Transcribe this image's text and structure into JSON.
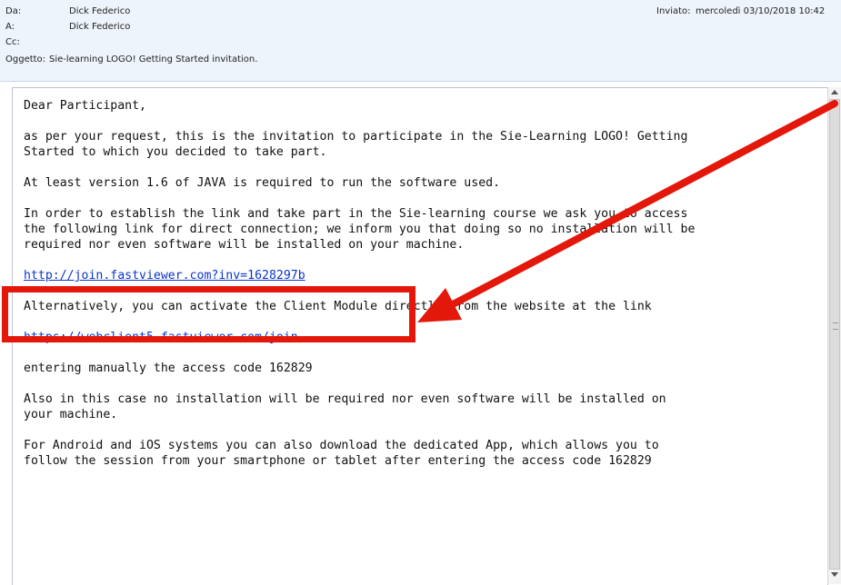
{
  "header": {
    "from_label": "Da:",
    "from_value": "Dick Federico",
    "to_label": "A:",
    "to_value": "Dick Federico",
    "cc_label": "Cc:",
    "cc_value": "",
    "subject_label": "Oggetto:",
    "subject_value": "Sie-learning LOGO! Getting Started invitation.",
    "sent_label": "Inviato:",
    "sent_value": "mercoledì 03/10/2018 10:42"
  },
  "body": {
    "greeting": "Dear Participant,",
    "p1": "as per your request, this is the invitation to participate in the Sie-Learning LOGO! Getting\nStarted to which you decided to take part.",
    "p2": "At least version 1.6 of JAVA is required to run the software used.",
    "p3": "In order to establish the link and take part in the Sie-learning course we ask you to access\nthe following link for direct connection; we inform you that doing so no installation will be\nrequired nor even software will be installed on your machine.",
    "link1": "http://join.fastviewer.com?inv=1628297b",
    "p4": "Alternatively, you can activate the Client Module directly from the website at the link",
    "link2": "https://webclient5.fastviewer.com/join",
    "p5": "entering manually the access code 162829",
    "p6": "Also in this case no installation will be required nor even software will be installed on\nyour machine.",
    "p7": "For Android and iOS systems you can also download the dedicated App, which allows you to\nfollow the session from your smartphone or tablet after entering the access code 162829"
  },
  "annotation": {
    "color": "#e3170a"
  }
}
